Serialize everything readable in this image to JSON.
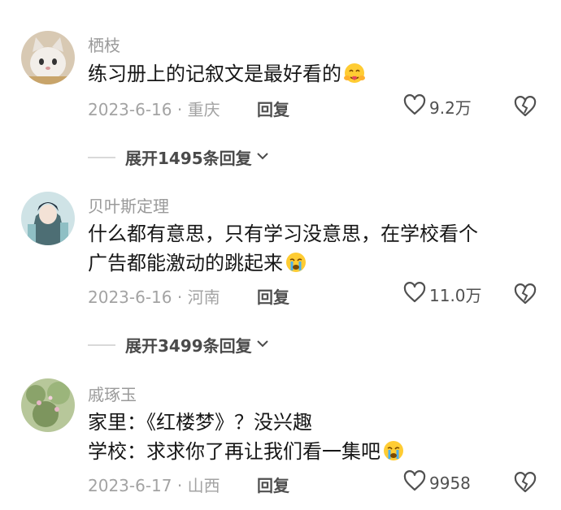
{
  "comments": [
    {
      "username": "栖枝",
      "lines": [
        "练习册上的记叙文是最好看的"
      ],
      "emoji": "hug-emoji",
      "meta": "2023-6-16 · 重庆",
      "reply_label": "回复",
      "like_count": "9.2万",
      "expand_label": "展开1495条回复"
    },
    {
      "username": "贝叶斯定理",
      "lines": [
        "什么都有意思，只有学习没意思，在学校看个",
        "广告都能激动的跳起来"
      ],
      "emoji": "crying-emoji",
      "meta": "2023-6-16 · 河南",
      "reply_label": "回复",
      "like_count": "11.0万",
      "expand_label": "展开3499条回复"
    },
    {
      "username": "戚琢玉",
      "lines": [
        "家里：《红楼梦》？没兴趣",
        "学校：求求你了再让我们看一集吧"
      ],
      "emoji": "crying-emoji",
      "meta": "2023-6-17 · 山西",
      "reply_label": "回复",
      "like_count": "9958"
    }
  ],
  "colors": {
    "username": "#9a9a9a",
    "text": "#161616",
    "meta": "#a3a3a3",
    "action": "#505050"
  }
}
